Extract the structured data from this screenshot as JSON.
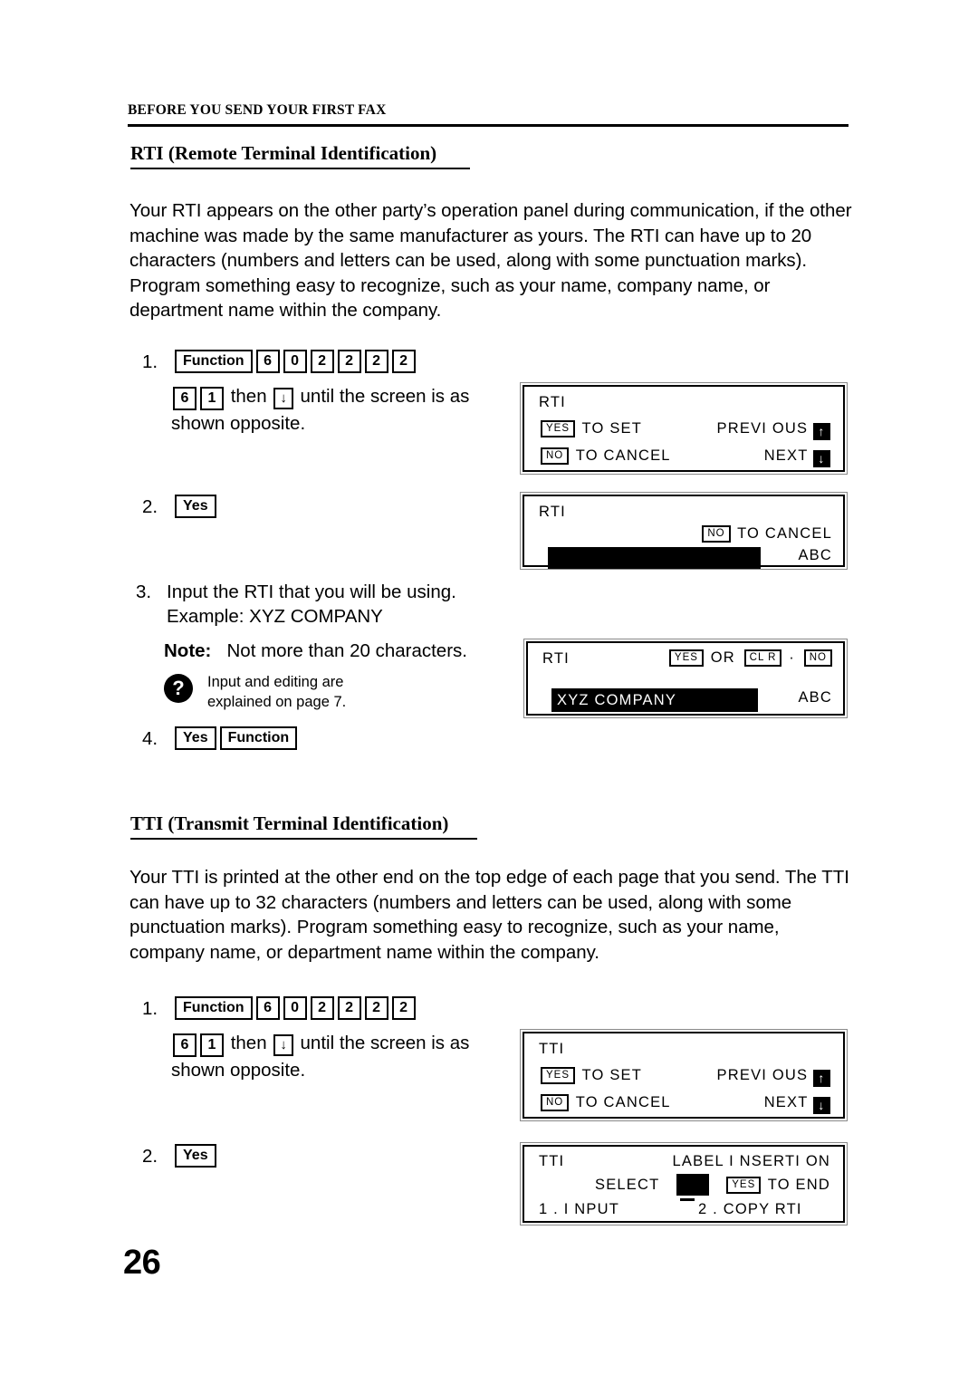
{
  "header": {
    "running_head": "BEFORE YOU SEND YOUR FIRST FAX"
  },
  "page_number": "26",
  "sections": [
    {
      "id": "rti",
      "heading": "RTI (Remote Terminal Identification)",
      "paragraph": "Your RTI appears on the other party’s operation panel during communication, if the other machine was made by the same manufacturer as yours. The RTI can have up to 20 characters (numbers and letters can be used, along with some punctuation marks). Program something easy to recognize, such as your name, company name, or department name within the company.",
      "steps": {
        "step1": {
          "number": "1.",
          "keys": [
            "Function",
            "6",
            "0",
            "2",
            "2",
            "2",
            "2"
          ],
          "line2_keys": [
            "6",
            "1"
          ],
          "line2_text_a": "then",
          "line2_arrow": "↓",
          "line2_text_b": "until the screen is as shown opposite."
        },
        "step2": {
          "number": "2.",
          "key": "Yes"
        },
        "step3": {
          "number": "3.",
          "line1": "Input the RTI that you will be using.",
          "line2": "Example: XYZ COMPANY",
          "note_label": "Note:",
          "note_text": "Not more than 20 characters.",
          "hint_icon": "question-icon",
          "hint_line1": "Input and editing are",
          "hint_line2": "explained on page 7."
        },
        "step4": {
          "number": "4.",
          "keys": [
            "Yes",
            "Function"
          ]
        }
      }
    },
    {
      "id": "tti",
      "heading": "TTI (Transmit Terminal Identification)",
      "paragraph": "Your TTI is printed at the other end on the top edge of each page that you send. The TTI can have up to 32 characters (numbers and letters can be used, along with some punctuation marks). Program something easy to recognize, such as your name, company name, or department name within the company.",
      "steps": {
        "step1": {
          "number": "1.",
          "keys": [
            "Function",
            "6",
            "0",
            "2",
            "2",
            "2",
            "2"
          ],
          "line2_keys": [
            "6",
            "1"
          ],
          "line2_text_a": "then",
          "line2_arrow": "↓",
          "line2_text_b": "until the screen is as shown opposite."
        },
        "step2": {
          "number": "2.",
          "key": "Yes"
        }
      }
    }
  ],
  "lcd_panels": {
    "rti_1": {
      "title": "RTI",
      "row1_key": "YES",
      "row1_label": "TO SET",
      "row1_right_label": "PREVI OUS",
      "row1_right_arrow": "↑",
      "row2_key": "NO",
      "row2_label": "TO CANCEL",
      "row2_right_label": "NEXT",
      "row2_right_arrow": "↓"
    },
    "rti_2": {
      "title": "RTI",
      "row1_key": "NO",
      "row1_label": "TO CANCEL",
      "field_value": "",
      "mode_label": "ABC"
    },
    "rti_3": {
      "title": "RTI",
      "row1_key_a": "YES",
      "row1_or": "OR",
      "row1_key_b": "CL R",
      "row1_dot": "·",
      "row1_key_c": "NO",
      "field_value": "XYZ COMPANY",
      "mode_label": "ABC"
    },
    "tti_1": {
      "title": "TTI",
      "row1_key": "YES",
      "row1_label": "TO SET",
      "row1_right_label": "PREVI OUS",
      "row1_right_arrow": "↑",
      "row2_key": "NO",
      "row2_label": "TO CANCEL",
      "row2_right_label": "NEXT",
      "row2_right_arrow": "↓"
    },
    "tti_2": {
      "title": "TTI",
      "title_right": "LABEL I NSERTI ON",
      "row2_label": "SELECT",
      "row2_key": "YES",
      "row2_key_label": "TO END",
      "row3_option1": "1 . I NPUT",
      "row3_option2": "2 . COPY RTI"
    }
  },
  "colors": {
    "ink": "#000000",
    "paper": "#ffffff",
    "panel_border": "#8a8a8a"
  }
}
